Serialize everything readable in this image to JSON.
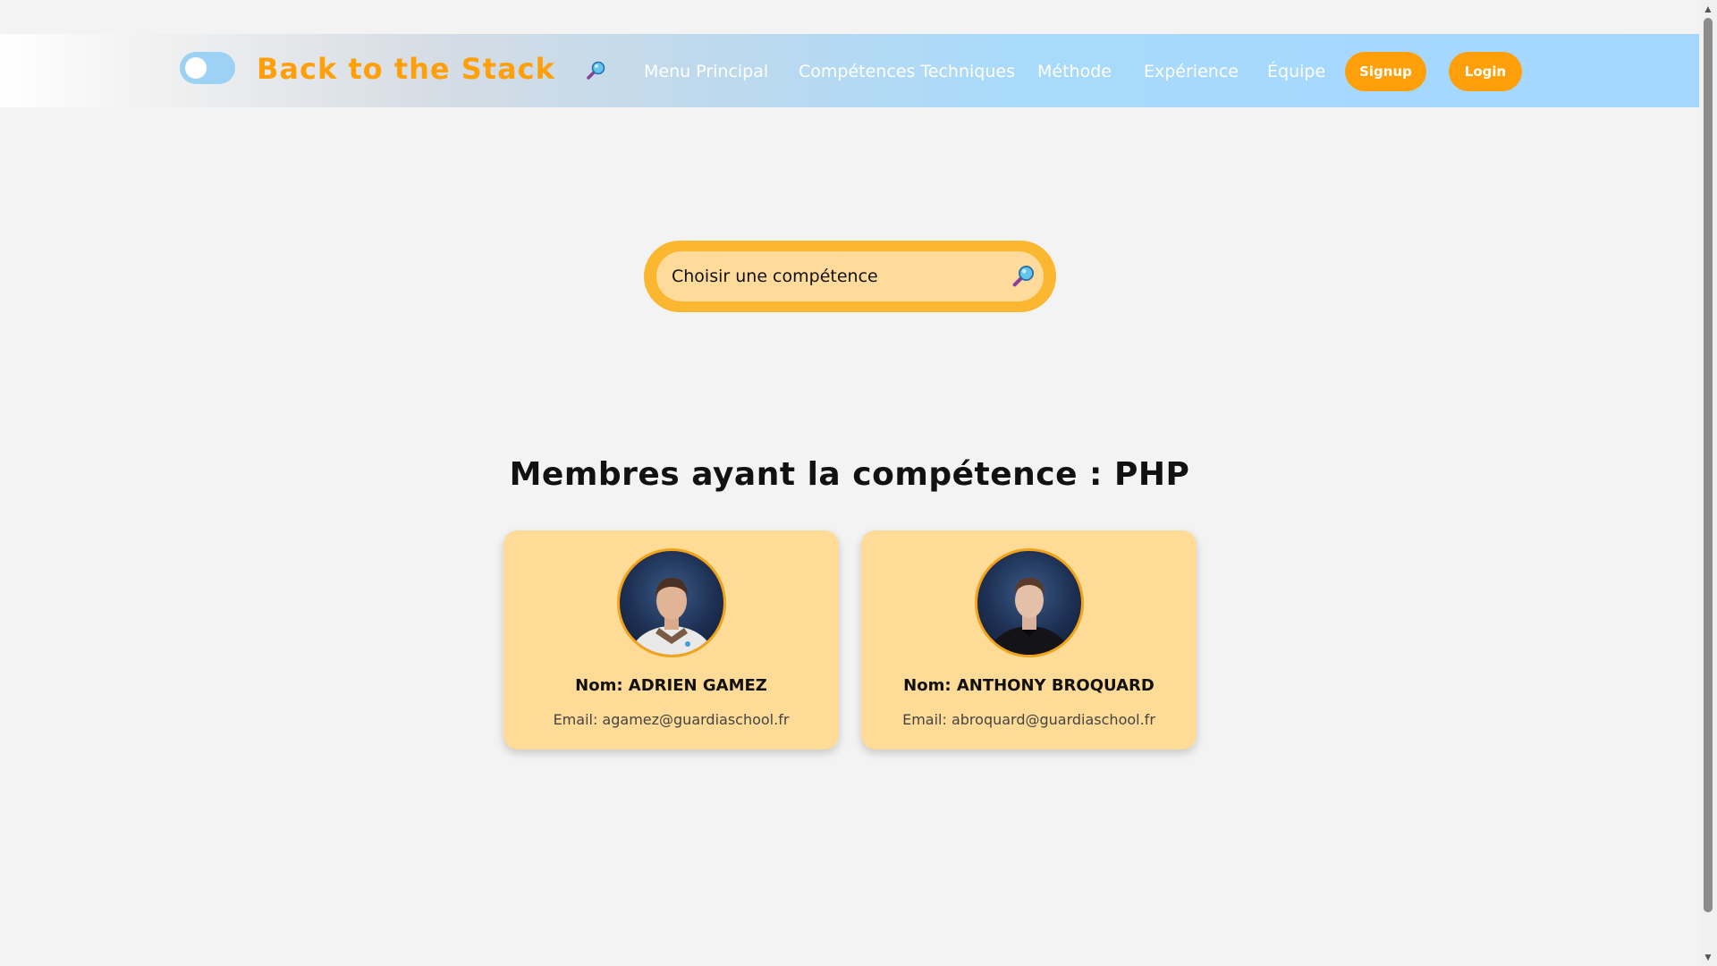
{
  "header": {
    "brand": "Back to the Stack",
    "nav": [
      {
        "label": "Menu Principal"
      },
      {
        "label": "Compétences Techniques"
      },
      {
        "label": "Méthode"
      },
      {
        "label": "Expérience"
      },
      {
        "label": "Équipe"
      }
    ],
    "signup_label": "Signup",
    "login_label": "Login",
    "theme_toggle_on": false
  },
  "search": {
    "placeholder": "Choisir une compétence"
  },
  "section": {
    "title": "Membres ayant la compétence : PHP"
  },
  "members": [
    {
      "name": "Nom: ADRIEN GAMEZ",
      "email": "Email: agamez@guardiaschool.fr"
    },
    {
      "name": "Nom: ANTHONY BROQUARD",
      "email": "Email: abroquard@guardiaschool.fr"
    }
  ],
  "colors": {
    "accent": "#ff9f0a",
    "card": "#fedb96",
    "search_border": "#fbb730",
    "header_blue": "#a3d7ff",
    "background": "#f3f3f3"
  },
  "icons": {
    "nav_search": "search-icon",
    "field_search": "search-icon",
    "scroll_up": "arrow-up-icon",
    "scroll_down": "arrow-down-icon"
  }
}
